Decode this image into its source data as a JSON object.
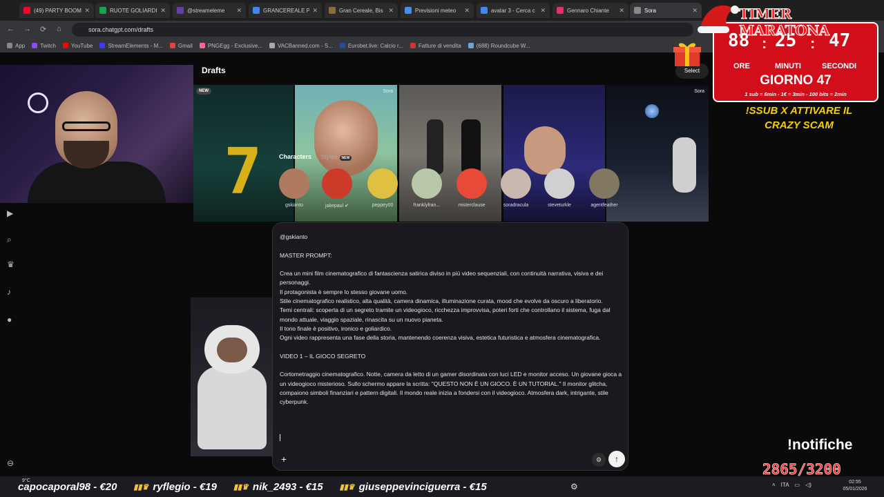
{
  "browser": {
    "tabs": [
      {
        "title": "(49) PARTY BOOM",
        "color": "#ff0033"
      },
      {
        "title": "RUOTE GOLIARDI",
        "color": "#17a34a"
      },
      {
        "title": "@streameleme",
        "color": "#6441a5"
      },
      {
        "title": "GRANCEREALE PI",
        "color": "#4285f4"
      },
      {
        "title": "Gran Cereale, Bis",
        "color": "#8a6d3b"
      },
      {
        "title": "Previsioni meteo",
        "color": "#4a8fe7"
      },
      {
        "title": "avatar 3 - Cerca c",
        "color": "#4285f4"
      },
      {
        "title": "Gennaro Chiante",
        "color": "#e1306c"
      },
      {
        "title": "Sora",
        "color": "#888888"
      }
    ],
    "url": "sora.chatgpt.com/drafts",
    "bookmarks": [
      {
        "label": "App",
        "color": "#888888"
      },
      {
        "label": "Twitch",
        "color": "#9146ff"
      },
      {
        "label": "YouTube",
        "color": "#ff0000"
      },
      {
        "label": "StreamElements - M...",
        "color": "#3b3bff"
      },
      {
        "label": "Gmail",
        "color": "#ea4335"
      },
      {
        "label": "PNGEgg - Exclusive...",
        "color": "#ff6699"
      },
      {
        "label": "VACBanned.com - S...",
        "color": "#aaaaaa"
      },
      {
        "label": "Eurobet.live: Calcio r...",
        "color": "#1f4ea3"
      },
      {
        "label": "Fatture di vendita",
        "color": "#d33333"
      },
      {
        "label": "(688) Roundcube W...",
        "color": "#66aadd"
      }
    ]
  },
  "page": {
    "title": "Drafts",
    "select_label": "Select",
    "new_badge": "NEW",
    "sora_mark": "Sora",
    "characters": {
      "tab_characters": "Characters",
      "tab_styles": "Styles",
      "styles_badge": "NEW",
      "items": [
        {
          "name": "gskianto",
          "color": "#b07a60"
        },
        {
          "name": "jakepaul",
          "color": "#cc3a2a",
          "verified": "✔"
        },
        {
          "name": "peppey00",
          "color": "#e0c040"
        },
        {
          "name": "franklyfran...",
          "color": "#b8c8a8"
        },
        {
          "name": "misterclause",
          "color": "#e84a3a"
        },
        {
          "name": "soradracula",
          "color": "#c8b8b0"
        },
        {
          "name": "steveturkle",
          "color": "#d0d0d0"
        },
        {
          "name": "agentfeather",
          "color": "#807860"
        }
      ]
    },
    "prompt": {
      "text": "@gskianto\n\nMASTER PROMPT:\n\nCrea un mini film cinematografico di fantascienza satirica diviso in più video sequenziali, con continuità narrativa, visiva e dei personaggi.\nIl protagonista è sempre lo stesso giovane uomo.\nStile cinematografico realistico, alta qualità, camera dinamica, illuminazione curata, mood che evolve da oscuro a liberatorio.\nTemi centrali: scoperta di un segreto tramite un videogioco, ricchezza improvvisa, poteri forti che controllano il sistema, fuga dal mondo attuale, viaggio spaziale, rinascita su un nuovo pianeta.\nIl tono finale è positivo, ironico e goliardico.\nOgni video rappresenta una fase della storia, mantenendo coerenza visiva, estetica futuristica e atmosfera cinematografica.\n\nVIDEO 1 – IL GIOCO SEGRETO\n\nCortometraggio cinematografico. Notte, camera da letto di un gamer disordinata con luci LED e monitor acceso. Un giovane gioca a un videogioco misterioso. Sullo schermo appare la scritta: \"QUESTO NON È UN GIOCO. È UN TUTORIAL.\" Il monitor glitcha, compaiono simboli finanziari e pattern digitali. Il mondo reale inizia a fondersi con il videogioco. Atmosfera dark, intrigante, stile cyberpunk.",
      "plus": "+",
      "settings": "⚙",
      "send": "↑"
    }
  },
  "overlay": {
    "timer_title": "TIMER MARATONA",
    "hours": "88",
    "minutes": "25",
    "seconds": "47",
    "hours_label": "ORE",
    "minutes_label": "MINUTI",
    "seconds_label": "SECONDI",
    "day": "GIORNO 47",
    "rates": "1 sub = 6min - 1€ = 3min - 100 bits = 2min",
    "scam": "!SSUB X ATTIVARE IL CRAZY SCAM",
    "notifiche": "!notifiche",
    "counter": "2865/3200",
    "colors": {
      "timer_bg": "#d20e1a",
      "scam": "#f5d000",
      "counter": "#ff3535"
    }
  },
  "taskbar": {
    "weather": "9°C",
    "ticker": [
      "capocaporal98 - €20",
      "ryflegio - €19",
      "nik_2493 - €15",
      "giuseppevinciguerra - €15"
    ],
    "lang": "ITA",
    "time": "02:55",
    "date": "05/01/2026"
  }
}
